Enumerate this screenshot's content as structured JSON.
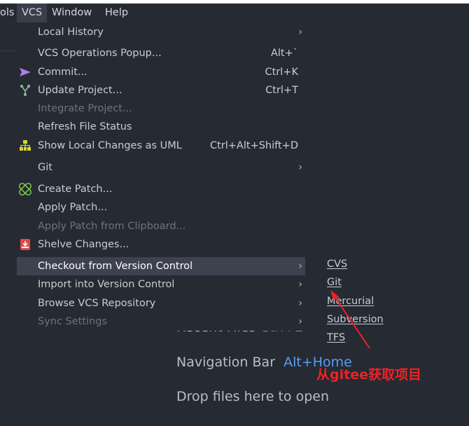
{
  "menubar": {
    "items": [
      {
        "label": "ols"
      },
      {
        "label": "VCS",
        "active": true
      },
      {
        "label": "Window"
      },
      {
        "label": "Help"
      }
    ]
  },
  "vcs_menu": {
    "items": [
      {
        "label": "Local History",
        "submenu": true
      },
      {
        "label": "VCS Operations Popup...",
        "shortcut": "Alt+`"
      },
      {
        "label": "Commit...",
        "shortcut": "Ctrl+K",
        "icon": "commit-arrow-icon"
      },
      {
        "label": "Update Project...",
        "shortcut": "Ctrl+T",
        "icon": "update-branch-icon"
      },
      {
        "label": "Integrate Project...",
        "disabled": true
      },
      {
        "label": "Refresh File Status"
      },
      {
        "label": "Show Local Changes as UML",
        "shortcut": "Ctrl+Alt+Shift+D",
        "icon": "uml-diagram-icon"
      },
      {
        "label": "Git",
        "submenu": true
      },
      {
        "label": "Create Patch...",
        "icon": "patch-icon"
      },
      {
        "label": "Apply Patch..."
      },
      {
        "label": "Apply Patch from Clipboard...",
        "disabled": true
      },
      {
        "label": "Shelve Changes...",
        "icon": "shelve-icon"
      },
      {
        "label": "Checkout from Version Control",
        "submenu": true,
        "highlighted": true
      },
      {
        "label": "Import into Version Control",
        "submenu": true
      },
      {
        "label": "Browse VCS Repository",
        "submenu": true
      },
      {
        "label": "Sync Settings",
        "submenu": true,
        "disabled": true
      }
    ]
  },
  "checkout_submenu": {
    "items": [
      "CVS",
      "Git",
      "Mercurial",
      "Subversion",
      "TFS"
    ]
  },
  "welcome": {
    "recent_files": "Recent Files",
    "recent_files_key": "Ctrl+E",
    "navigation_bar": "Navigation Bar",
    "navigation_bar_key": "Alt+Home",
    "drop_files": "Drop files here to open"
  },
  "annotation": {
    "text": "从gitee获取项目",
    "color": "#ee2222"
  },
  "colors": {
    "background": "#262a33",
    "highlight": "#3e4250",
    "shortcut_key": "#589df6"
  }
}
